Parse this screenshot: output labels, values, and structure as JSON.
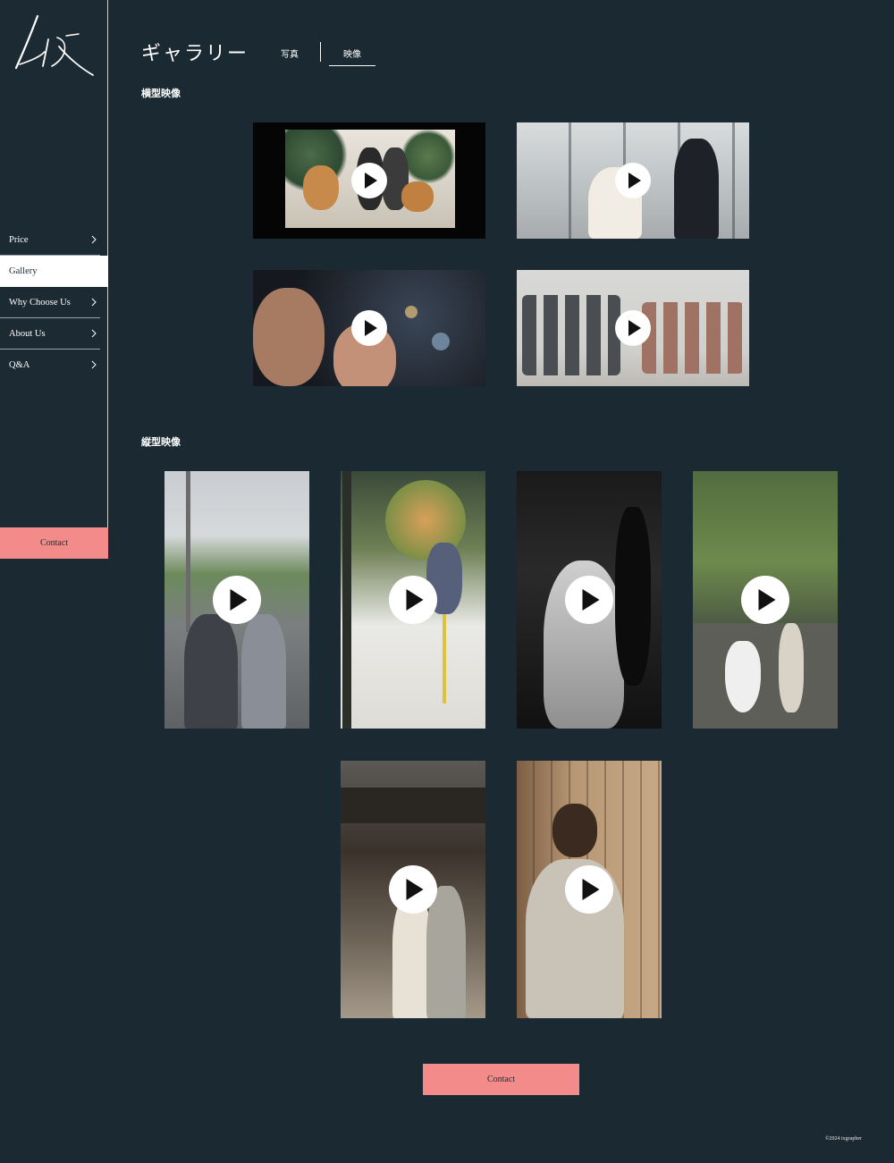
{
  "sidebar": {
    "nav": [
      {
        "label": "Price",
        "active": false
      },
      {
        "label": "Gallery",
        "active": true
      },
      {
        "label": "Why Choose Us",
        "active": false
      },
      {
        "label": "About Us",
        "active": false
      },
      {
        "label": "Q&A",
        "active": false
      }
    ],
    "contact_label": "Contact"
  },
  "header": {
    "title": "ギャラリー",
    "tabs": [
      {
        "label": "写真",
        "active": false
      },
      {
        "label": "映像",
        "active": true
      }
    ]
  },
  "sections": {
    "horizontal_title": "横型映像",
    "vertical_title": "縦型映像"
  },
  "videos": {
    "horizontal_count": 4,
    "vertical_count": 6,
    "play_icon": "play-circle-icon"
  },
  "footer": {
    "contact_label": "Contact",
    "copyright": "©2024 ixgrapher"
  },
  "colors": {
    "background": "#1b2932",
    "accent": "#f28b8a",
    "text": "#ffffff"
  }
}
